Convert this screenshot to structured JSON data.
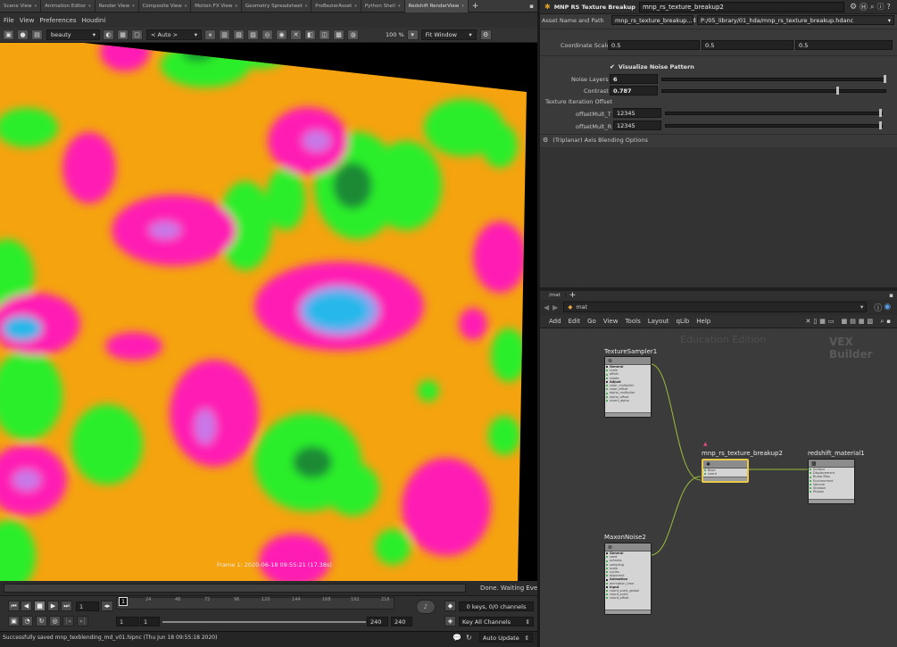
{
  "top_tabs": [
    "Scene View",
    "Animation Editor",
    "Render View",
    "Composite View",
    "Motion FX View",
    "Geometry Spreadsheet",
    "ProBezierAsset",
    "Python Shell",
    "Redshift RenderView"
  ],
  "menu_left": [
    "File",
    "View",
    "Preferences",
    "Houdini"
  ],
  "viewer_toolbar": {
    "aov_select": "beauty",
    "camera_select": "< Auto >",
    "zoom": "100 %",
    "fit": "Fit Window"
  },
  "viewport": {
    "frame_label": "Frame 1:  2020-06-18  09:55:21  (17.38s)"
  },
  "render_status": "Done. Waiting Events",
  "timeline": {
    "current_frame": "1",
    "start_frame": "1",
    "range_start": "1",
    "range_end": "240",
    "end_frame": "240",
    "ruler_ticks": [
      "24",
      "48",
      "72",
      "96",
      "120",
      "144",
      "168",
      "192",
      "216"
    ],
    "keys_label": "0 keys, 0/0 channels",
    "key_all": "Key All Channels",
    "auto_update": "Auto Update"
  },
  "status_message": "Successfully saved mnp_texblending_md_v01.hipnc (Thu Jun 18 09:55:18 2020)",
  "param_pane": {
    "node_type": "MNP RS Texture Breakup",
    "node_name": "mnp_rs_texture_breakup2",
    "asset_label": "Asset Name and Path",
    "asset_name": "mnp_rs_texture_breakup...",
    "asset_path": "P:/05_library/01_hda/mnp_rs_texture_breakup.hdanc",
    "coord_scale_label": "Coordinate Scale",
    "coord_scale": [
      "0.5",
      "0.5",
      "0.5"
    ],
    "visualize_label": "Visualize Noise Pattern",
    "noise_layers_label": "Noise Layers",
    "noise_layers": "6",
    "contrast_label": "Contrast",
    "contrast": "0.787",
    "iteration_label": "Texture Iteration Offset",
    "offset_t_label": "offsetMult_T",
    "offset_t": "12345",
    "offset_r_label": "offsetMult_R",
    "offset_r": "12345",
    "folder_label": "(Triplanar) Axis Blending Options"
  },
  "network": {
    "tab": "/mat",
    "path": "mat",
    "menu": [
      "Add",
      "Edit",
      "Go",
      "View",
      "Tools",
      "Layout",
      "qLib",
      "Help"
    ],
    "watermark": "Education Edition",
    "context": "VEX Builder",
    "nodes": {
      "sampler": {
        "title": "TextureSampler1",
        "rows": [
          "General",
          "scale",
          "offset",
          "rotate",
          "Adjust",
          "color_multiplier",
          "color_offset",
          "alpha_multiplier",
          "alpha_offset",
          "invert_alpha"
        ]
      },
      "breakup": {
        "title": "mnp_rs_texture_breakup2",
        "rows": [
          "Base",
          "coord"
        ]
      },
      "material": {
        "title": "redshift_material1",
        "rows": [
          "Surface",
          "Displacement",
          "Bump Map",
          "Environment",
          "Volume",
          "Shadow",
          "Photon"
        ]
      },
      "noise": {
        "title": "MaxonNoise2",
        "rows": [
          "General",
          "seed",
          "octaves",
          "sampling",
          "scale",
          "cycles",
          "exponent",
          "Animation",
          "animation_time",
          "Input",
          "coord_scale_global",
          "coord_scale",
          "coord_offset"
        ]
      }
    }
  },
  "colors": {
    "noise_orange": "#f5a30f",
    "noise_magenta": "#ff1ab4",
    "noise_green": "#29ee2a",
    "noise_cyan": "#25b8ea",
    "node_selected": "#e8c84a",
    "wire": "#9abe3a"
  }
}
